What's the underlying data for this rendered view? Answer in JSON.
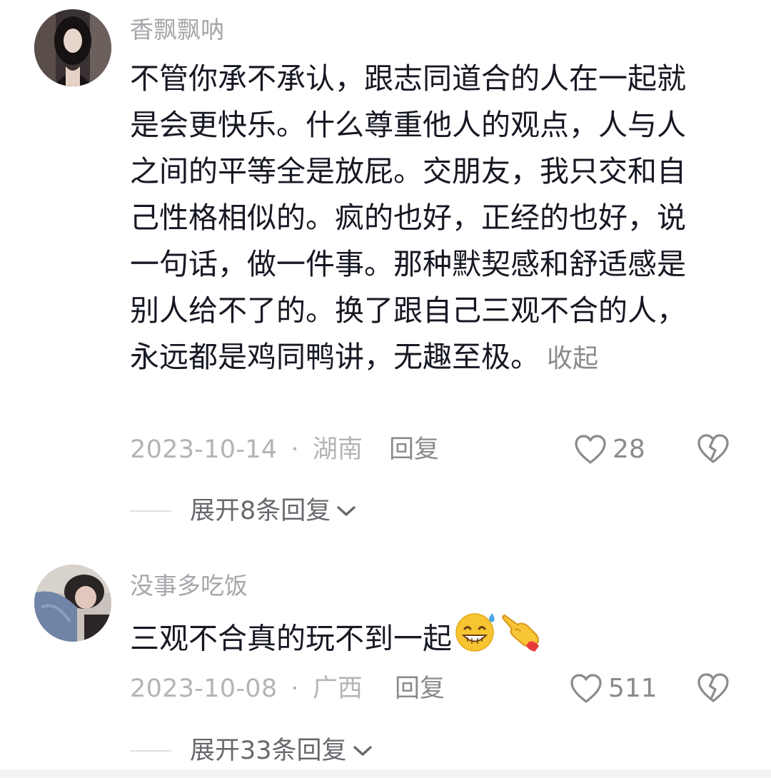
{
  "comments": [
    {
      "username": "香飘飘呐",
      "text": "不管你承不承认，跟志同道合的人在一起就是会更快乐。什么尊重他人的观点，人与人之间的平等全是放屁。交朋友，我只交和自己性格相似的。疯的也好，正经的也好，说一句话，做一件事。那种默契感和舒适感是别人给不了的。换了跟自己三观不合的人，永远都是鸡同鸭讲，无趣至极。",
      "collapse_label": "收起",
      "date": "2023-10-14",
      "separator": "·",
      "location": "湖南",
      "reply_label": "回复",
      "likes": "28",
      "expand_label": "展开8条回复"
    },
    {
      "username": "没事多吃饭",
      "text": "三观不合真的玩不到一起",
      "emojis": [
        "grinning-sweat-emoji",
        "pointing-hand-emoji"
      ],
      "date": "2023-10-08",
      "separator": "·",
      "location": "广西",
      "reply_label": "回复",
      "likes": "511",
      "expand_label": "展开33条回复"
    }
  ],
  "icons": {
    "like": "heart-outline-icon",
    "dislike": "broken-heart-icon",
    "expand": "chevron-down-icon"
  },
  "colors": {
    "username": "#a6a6ab",
    "text": "#161823",
    "meta": "#b4b4b8",
    "secondary": "#8a8a8f",
    "expand": "#68686e"
  }
}
